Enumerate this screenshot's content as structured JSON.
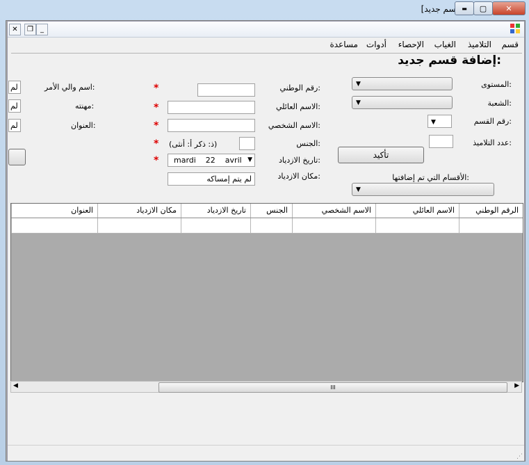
{
  "window": {
    "title": "[تدبير الغياب - [قسم جديد",
    "minimize": "▬",
    "maximize": "▢",
    "close": "✕"
  },
  "child_window": {
    "close": "✕",
    "restore": "❐",
    "minimize": "_"
  },
  "menu": {
    "items": [
      "قسم",
      "التلاميذ",
      "الغياب",
      "الإحصاء",
      "أدوات",
      "مساعدة"
    ]
  },
  "form": {
    "heading": "إضافة قسم جديد:",
    "class_panel": {
      "level_label": "المستوى:",
      "branch_label": "الشعبة:",
      "class_number_label": "رقم القسم:",
      "student_count_label": "عدد التلاميذ:",
      "confirm_button": "تأكيد",
      "added_classes_label": "الأقسام التي تم إضافتها:"
    },
    "student_panel": {
      "national_id_label": "رقم الوطني:",
      "family_name_label": "الاسم العائلي:",
      "first_name_label": "الاسم الشخصي:",
      "gender_label": "الجنس:",
      "gender_hint": "(ذ: ذكر  أ: أنثى)",
      "birth_date_label": "تاريخ الازدياد:",
      "birth_date_value": "mardi    22    avril",
      "birth_place_label": "مكان الازدياد:",
      "birth_place_value": "لم يتم إمساكه",
      "required_mark": "*"
    },
    "parent_panel": {
      "guardian_label": "اسم والي الأمر:",
      "profession_label": "مهنته:",
      "address_label": "العنوان:",
      "guardian_value": "لم",
      "profession_value": "لم",
      "address_value": "لم"
    }
  },
  "grid": {
    "columns": [
      "الرقم الوطني",
      "الاسم العائلي",
      "الاسم الشخصي",
      "الجنس",
      "تاريخ الازدياد",
      "مكان الازدياد",
      "العنوان"
    ]
  },
  "scrollbar": {
    "thumb_grip": "III",
    "left_arrow": "◀",
    "right_arrow": "▶"
  }
}
